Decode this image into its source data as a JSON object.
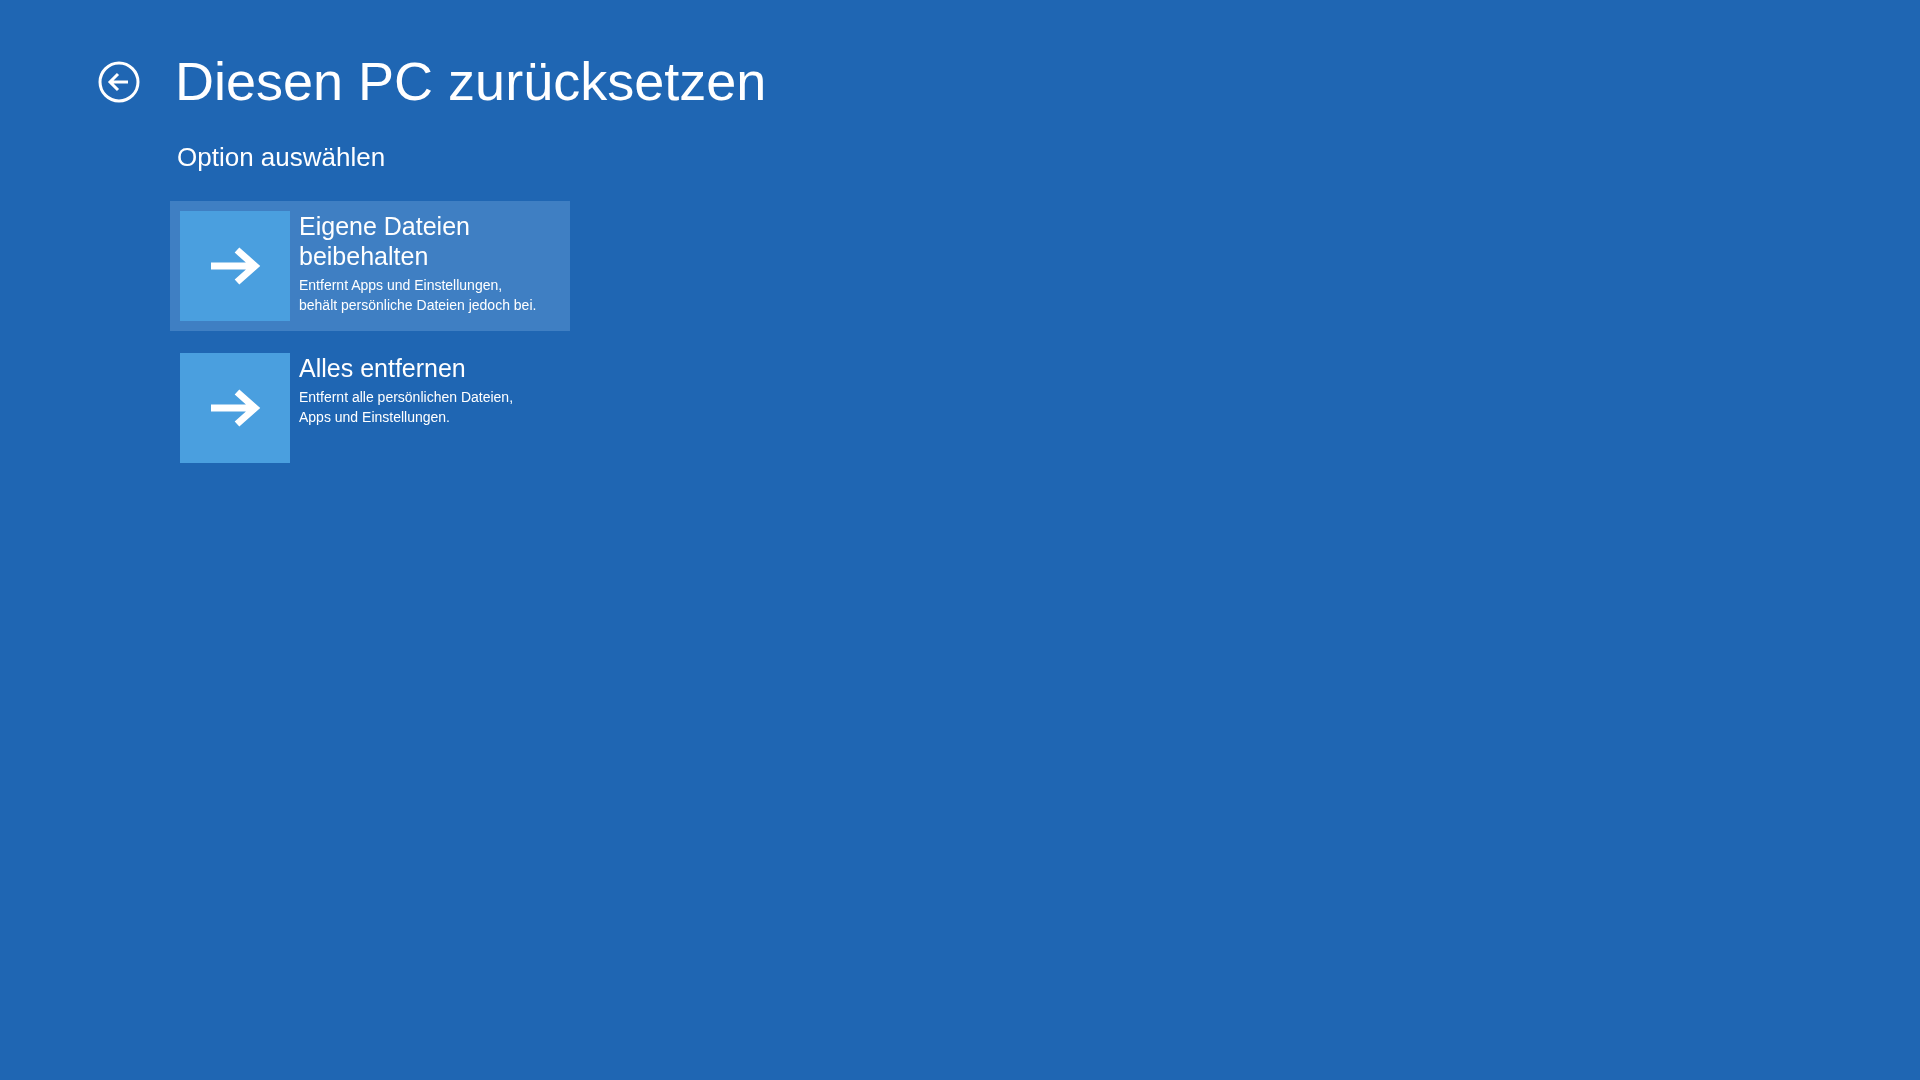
{
  "title": "Diesen PC zurücksetzen",
  "subtitle": "Option auswählen",
  "options": [
    {
      "title": "Eigene Dateien beibehalten",
      "description_lines": [
        "Entfernt Apps und Einstellungen,",
        "behält persönliche Dateien jedoch bei."
      ],
      "selected": true
    },
    {
      "title": "Alles entfernen",
      "description_lines": [
        "Entfernt alle persönlichen Dateien,",
        "Apps und Einstellungen."
      ],
      "selected": false
    }
  ]
}
